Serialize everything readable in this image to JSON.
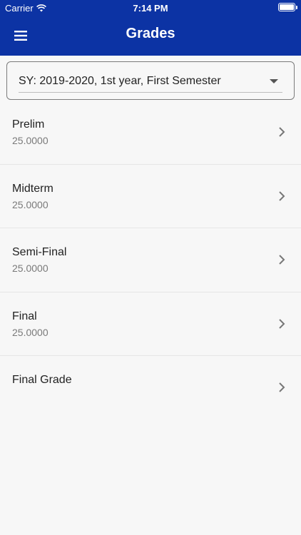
{
  "status_bar": {
    "carrier": "Carrier",
    "time": "7:14 PM"
  },
  "header": {
    "title": "Grades"
  },
  "dropdown": {
    "value": "SY: 2019-2020, 1st year, First Semester"
  },
  "grades": [
    {
      "label": "Prelim",
      "value": "25.0000"
    },
    {
      "label": "Midterm",
      "value": "25.0000"
    },
    {
      "label": "Semi-Final",
      "value": "25.0000"
    },
    {
      "label": "Final",
      "value": "25.0000"
    },
    {
      "label": "Final Grade",
      "value": ""
    }
  ],
  "colors": {
    "header": "#0c33a4",
    "background": "#f7f7f7"
  },
  "icons": {
    "menu": "hamburger-icon",
    "row": "chevron-right-icon",
    "dropdown": "caret-down-icon"
  }
}
